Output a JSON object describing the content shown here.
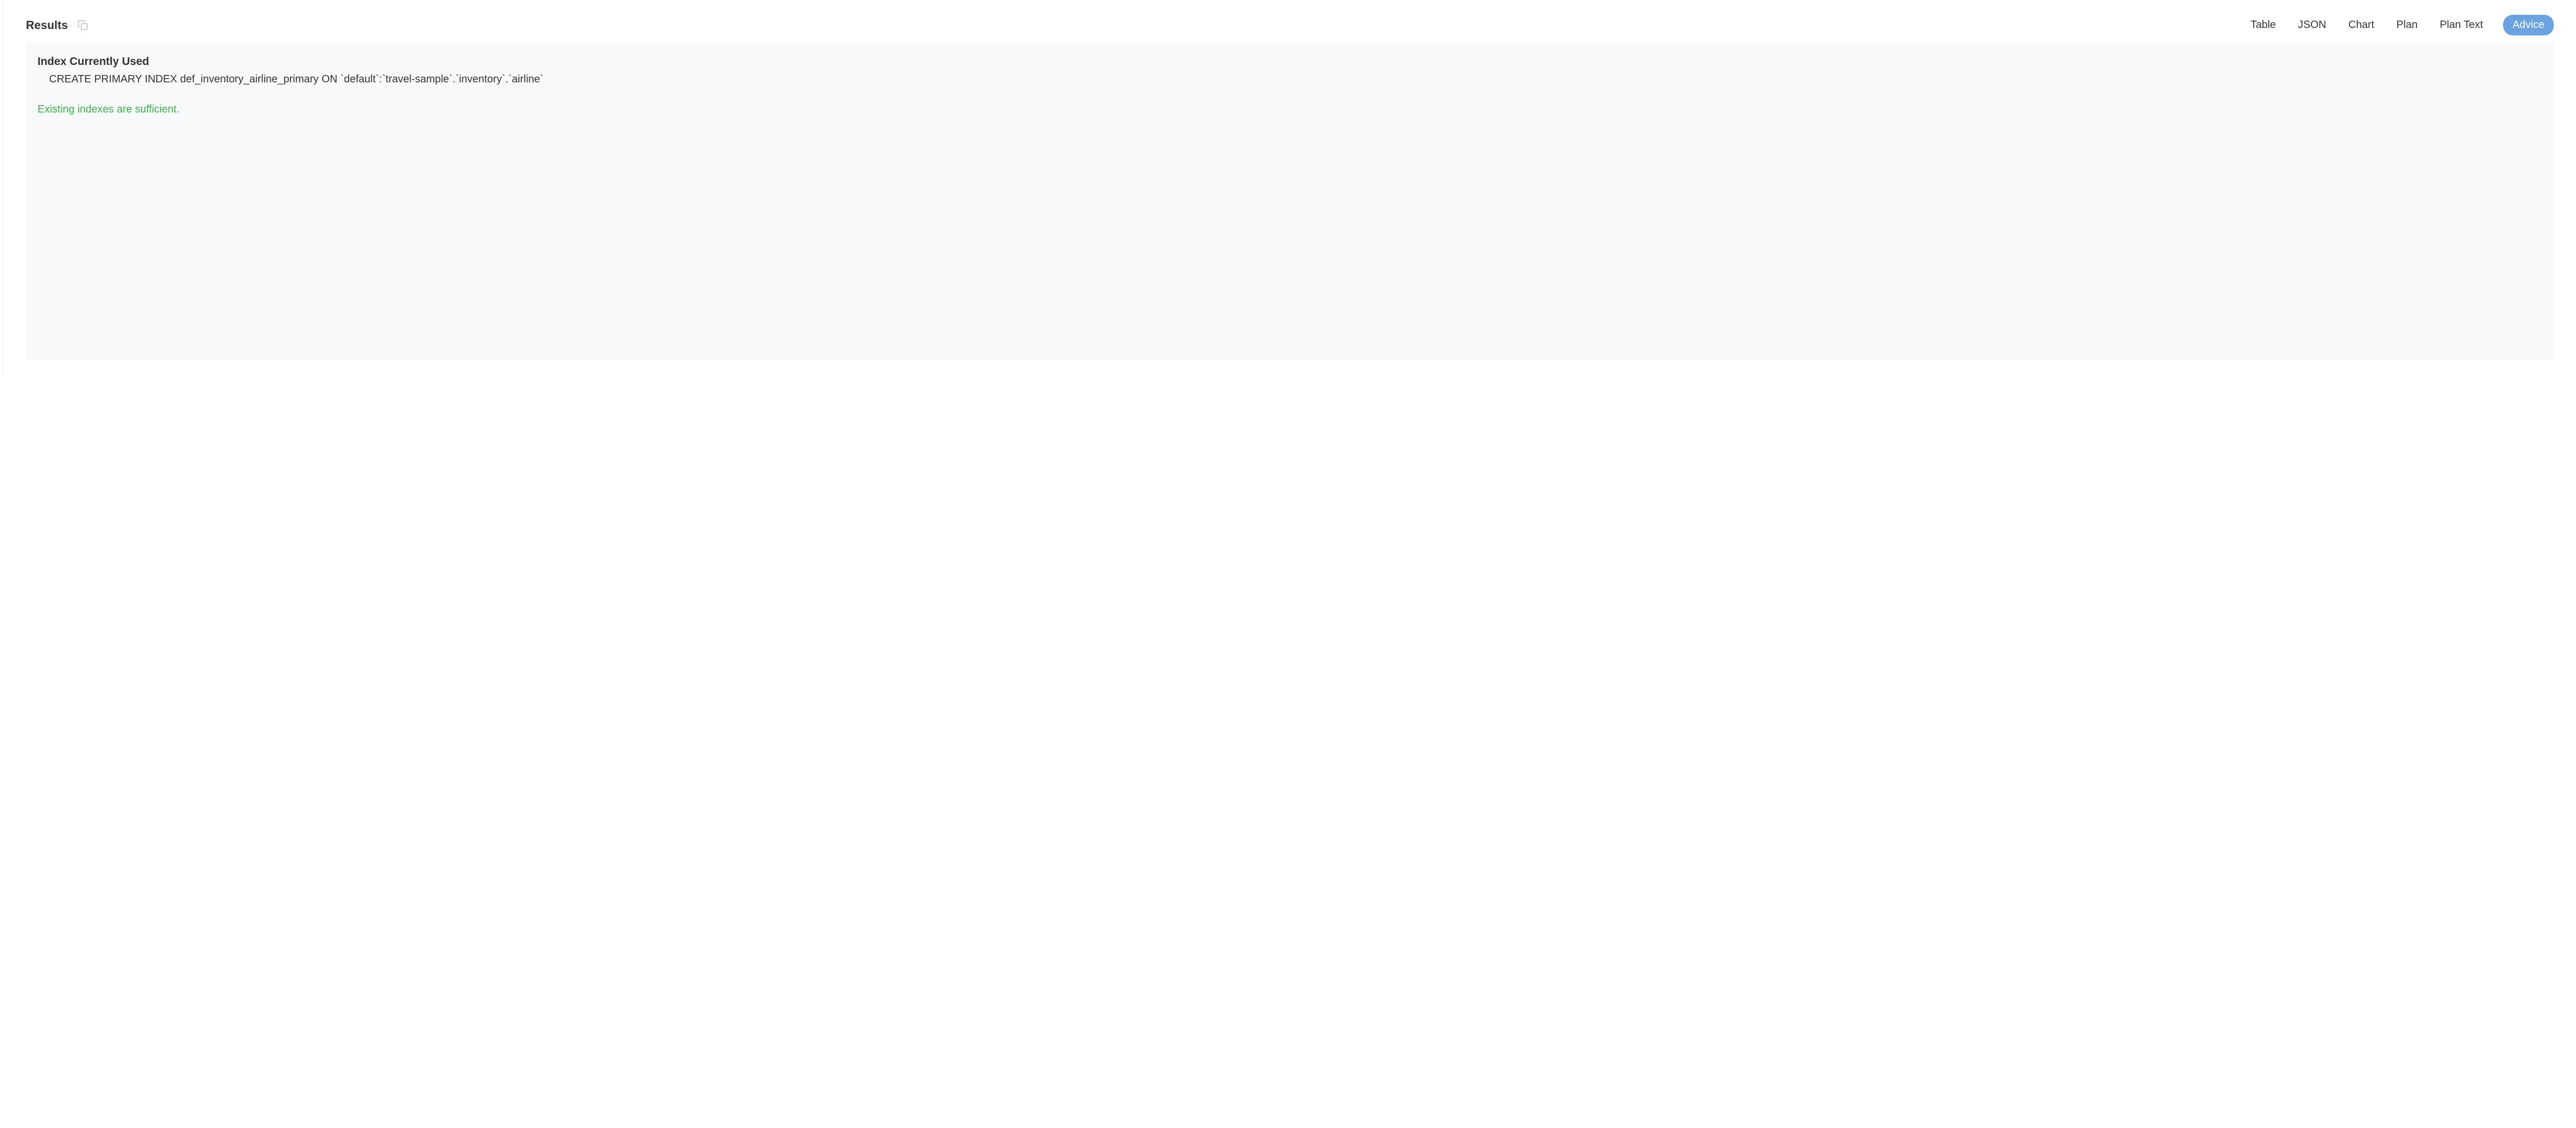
{
  "header": {
    "title": "Results"
  },
  "tabs": {
    "table": "Table",
    "json": "JSON",
    "chart": "Chart",
    "plan": "Plan",
    "plan_text": "Plan Text",
    "advice": "Advice"
  },
  "content": {
    "section_heading": "Index Currently Used",
    "index_statement": "CREATE PRIMARY INDEX def_inventory_airline_primary ON `default`:`travel-sample`.`inventory`.`airline`",
    "sufficient_message": "Existing indexes are sufficient."
  }
}
